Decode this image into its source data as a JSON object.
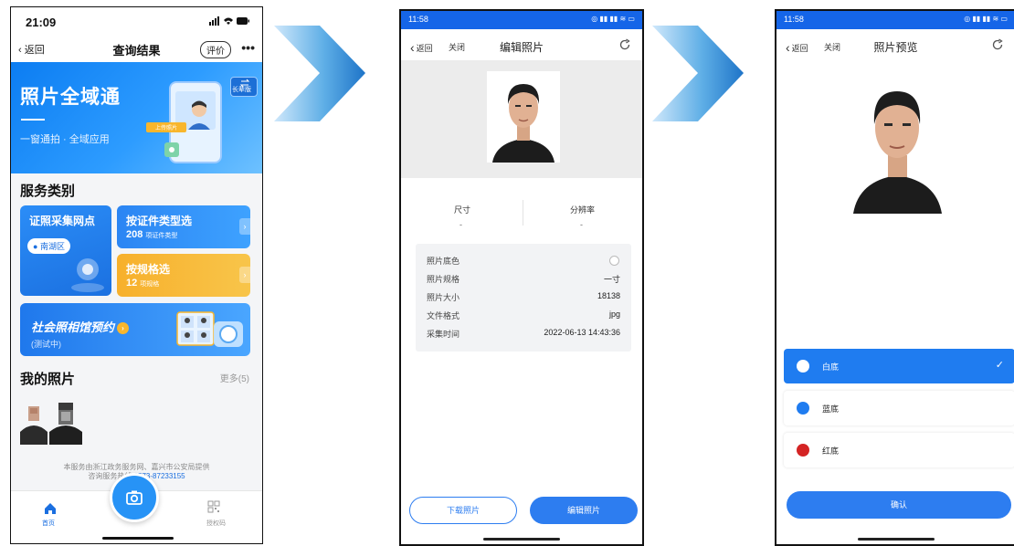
{
  "screen1": {
    "status_time": "21:09",
    "nav": {
      "back": "返回",
      "title": "查询结果",
      "rate": "评价",
      "more": "•••"
    },
    "banner": {
      "title": "照片全域通",
      "subtitle": "一窗通拍 · 全域应用",
      "upload_label": "上传照片",
      "elder_mode": "长辈版"
    },
    "service_title": "服务类别",
    "cards": {
      "collection_point": {
        "title": "证照采集网点",
        "location": "南湖区"
      },
      "by_doc_type": {
        "title": "按证件类型选",
        "count": "208",
        "unit": "项证件类型"
      },
      "by_spec": {
        "title": "按规格选",
        "count": "12",
        "unit": "项规格"
      },
      "studio": {
        "title": "社会照相馆预约",
        "subtitle": "(测试中)"
      }
    },
    "my_photos": {
      "title": "我的照片",
      "more": "更多(5)"
    },
    "footer": {
      "line1": "本服务由浙江政务服务网、嘉兴市公安局提供",
      "line2_prefix": "咨询服务热线:",
      "line2_phone": "0573-87233155"
    },
    "tabbar": {
      "home": "首页",
      "code": "授权码"
    }
  },
  "screen2": {
    "status_time": "11:58",
    "nav": {
      "back": "返回",
      "close": "关闭",
      "title": "编辑照片"
    },
    "columns": [
      {
        "label": "尺寸",
        "value": "-"
      },
      {
        "label": "分辨率",
        "value": "-"
      }
    ],
    "details": [
      {
        "label": "照片底色",
        "value": ""
      },
      {
        "label": "照片规格",
        "value": "一寸"
      },
      {
        "label": "照片大小",
        "value": "18138"
      },
      {
        "label": "文件格式",
        "value": "jpg"
      },
      {
        "label": "采集时间",
        "value": "2022-06-13 14:43:36"
      }
    ],
    "buttons": {
      "download": "下载照片",
      "edit": "编辑照片"
    }
  },
  "screen3": {
    "status_time": "11:58",
    "nav": {
      "back": "返回",
      "close": "关闭",
      "title": "照片预览"
    },
    "options": [
      {
        "label": "白底",
        "color": "#ffffff",
        "selected": true
      },
      {
        "label": "蓝底",
        "color": "#1f7cf0",
        "selected": false
      },
      {
        "label": "红底",
        "color": "#d42424",
        "selected": false
      }
    ],
    "confirm": "确认"
  },
  "colors": {
    "primary": "#1f7cf0",
    "status_bar": "#1565e8",
    "accent_orange": "#f8b62d"
  }
}
